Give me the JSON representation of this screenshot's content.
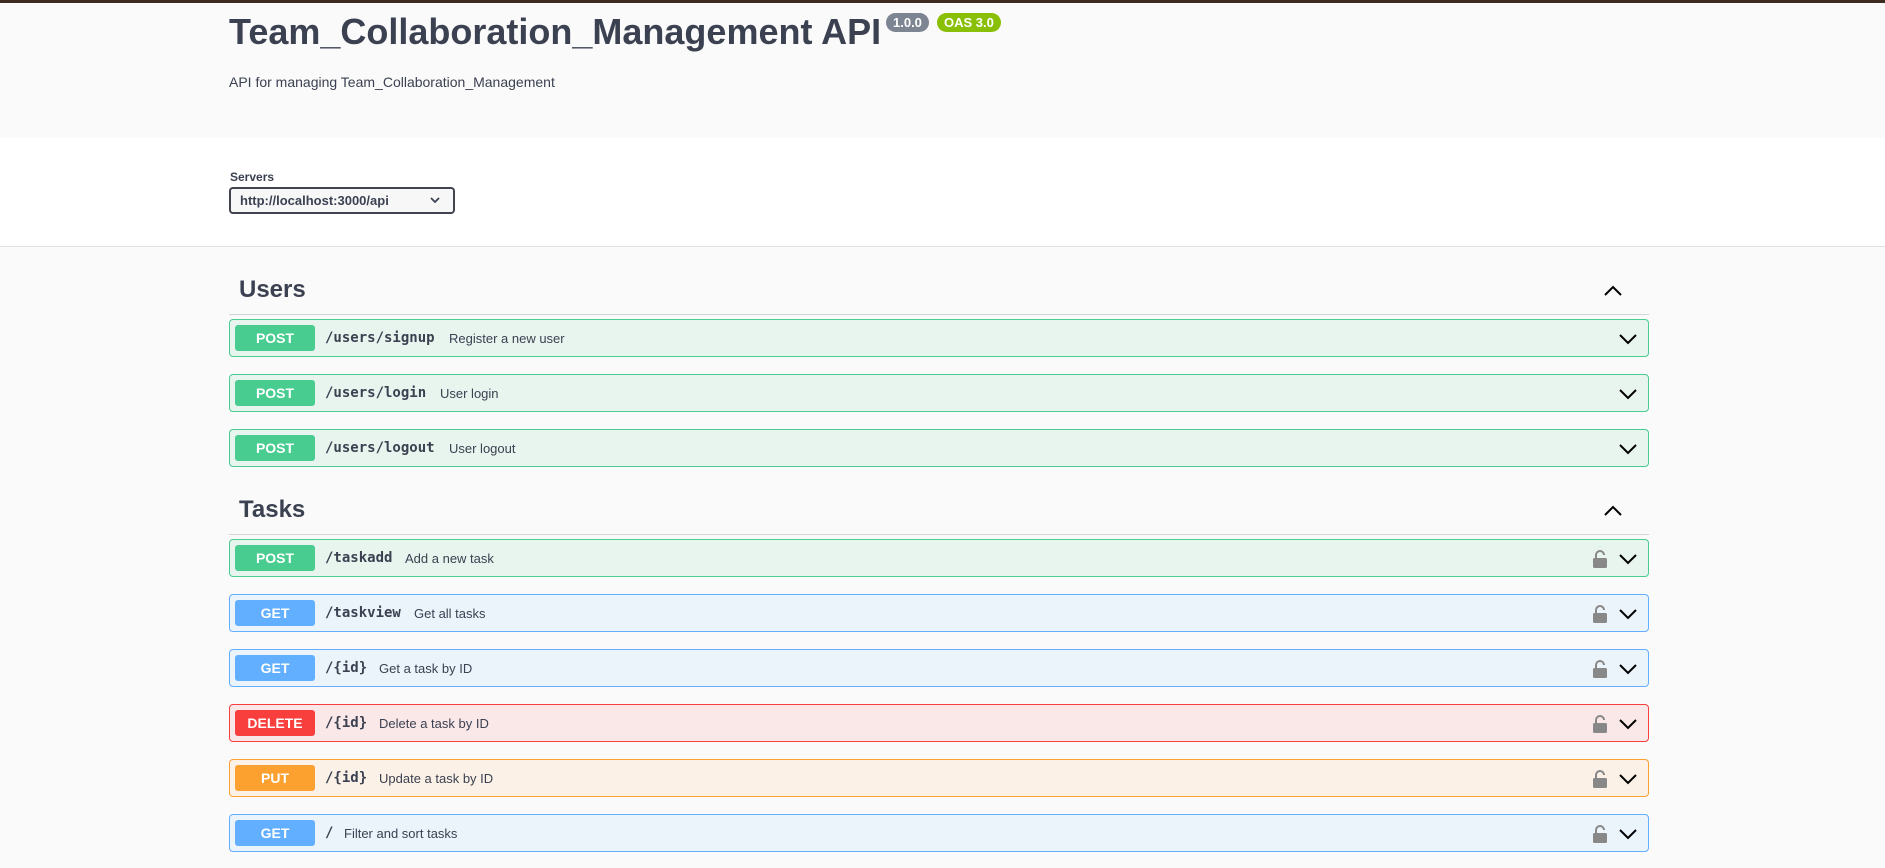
{
  "info": {
    "title": "Team_Collaboration_Management API",
    "version": "1.0.0",
    "oas": "OAS 3.0",
    "description": "API for managing Team_Collaboration_Management"
  },
  "servers": {
    "label": "Servers",
    "selected": "http://localhost:3000/api"
  },
  "colors": {
    "post": "#49cc90",
    "get": "#61affe",
    "delete": "#f93e3e",
    "put": "#fca130"
  },
  "sections": [
    {
      "title": "Users",
      "operations": [
        {
          "method": "POST",
          "path": "/users/signup",
          "summary": "Register a new user",
          "locked": false
        },
        {
          "method": "POST",
          "path": "/users/login",
          "summary": "User login",
          "locked": false
        },
        {
          "method": "POST",
          "path": "/users/logout",
          "summary": "User logout",
          "locked": false
        }
      ]
    },
    {
      "title": "Tasks",
      "operations": [
        {
          "method": "POST",
          "path": "/taskadd",
          "summary": "Add a new task",
          "locked": true
        },
        {
          "method": "GET",
          "path": "/taskview",
          "summary": "Get all tasks",
          "locked": true
        },
        {
          "method": "GET",
          "path": "/{id}",
          "summary": "Get a task by ID",
          "locked": true
        },
        {
          "method": "DELETE",
          "path": "/{id}",
          "summary": "Delete a task by ID",
          "locked": true
        },
        {
          "method": "PUT",
          "path": "/{id}",
          "summary": "Update a task by ID",
          "locked": true
        },
        {
          "method": "GET",
          "path": "/",
          "summary": "Filter and sort tasks",
          "locked": true
        }
      ]
    }
  ]
}
